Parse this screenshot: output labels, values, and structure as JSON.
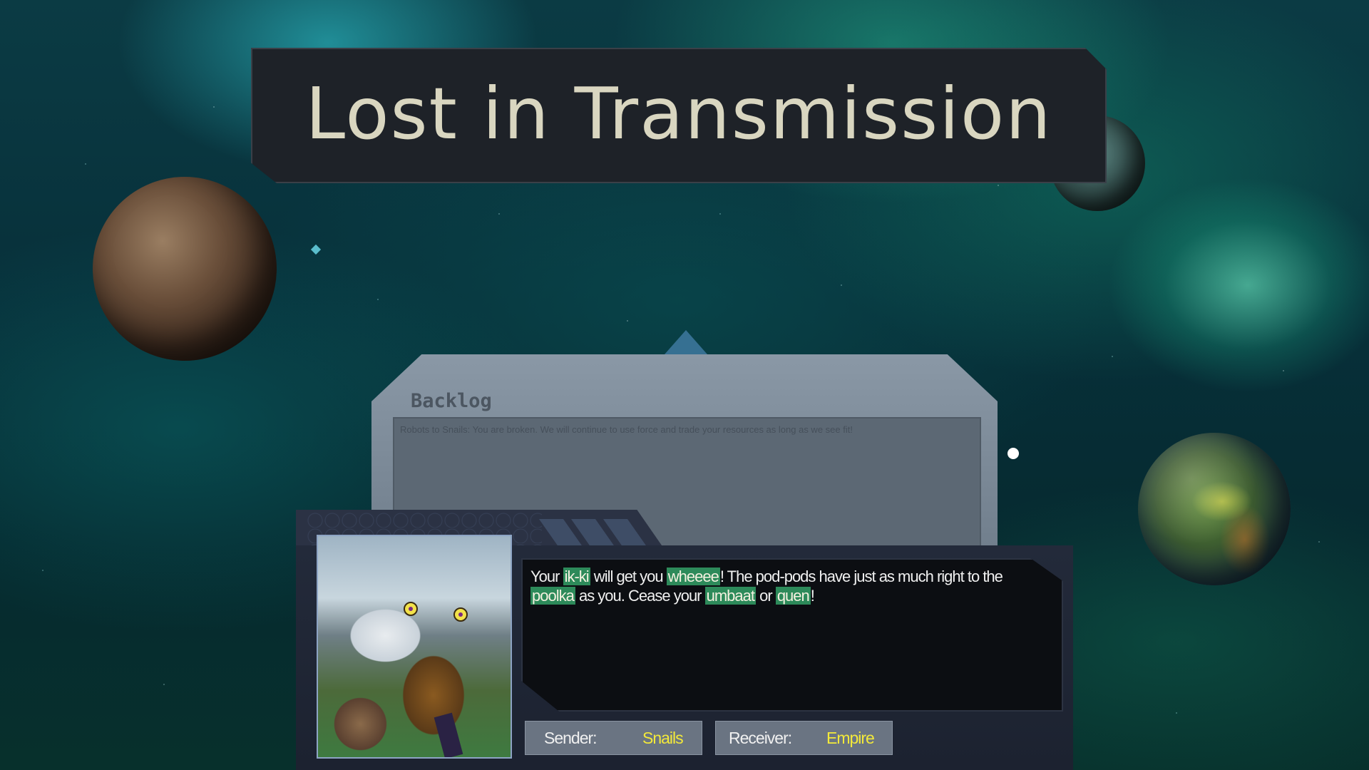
{
  "title": "Lost in Transmission",
  "backlog": {
    "heading": "Backlog",
    "entries": [
      "Robots to Snails: You are broken. We will continue to use force and trade your resources as long as we see fit!"
    ]
  },
  "message": {
    "parts": [
      {
        "text": "Your ",
        "highlight": false
      },
      {
        "text": "ik-ki",
        "highlight": true
      },
      {
        "text": " will get you ",
        "highlight": false
      },
      {
        "text": "wheeee",
        "highlight": true
      },
      {
        "text": "! The pod-pods have just as much right to the ",
        "highlight": false
      },
      {
        "text": "poolka",
        "highlight": true
      },
      {
        "text": " as you. Cease your ",
        "highlight": false
      },
      {
        "text": "umbaat",
        "highlight": true
      },
      {
        "text": " or ",
        "highlight": false
      },
      {
        "text": "quen",
        "highlight": true
      },
      {
        "text": "!",
        "highlight": false
      }
    ],
    "highlight_color": "#2d8a5a"
  },
  "sender": {
    "label": "Sender:",
    "value": "Snails"
  },
  "receiver": {
    "label": "Receiver:",
    "value": "Empire"
  },
  "colors": {
    "title_text": "#d9d6c0",
    "tag_value": "#f3e93a",
    "panel": "#1e2228"
  }
}
